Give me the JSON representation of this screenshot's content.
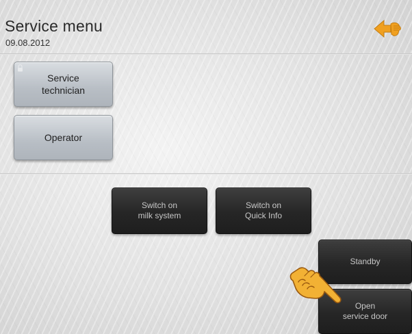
{
  "header": {
    "title": "Service menu",
    "date": "09.08.2012"
  },
  "roles": {
    "service_technician_label": "Service\ntechnician",
    "operator_label": "Operator"
  },
  "actions": {
    "switch_milk_label": "Switch on\nmilk system",
    "switch_quick_label": "Switch on\nQuick Info",
    "standby_label": "Standby",
    "open_door_label": "Open\nservice door"
  },
  "icons": {
    "back": "back-arrow-icon",
    "lock": "lock-icon",
    "pointer": "hand-pointer-icon"
  },
  "colors": {
    "back_icon": "#f0a020",
    "pointer_fill": "#f2b134",
    "pointer_stroke": "#9a5a10",
    "dark_button": "#262626",
    "role_button": "#b8bec5"
  }
}
